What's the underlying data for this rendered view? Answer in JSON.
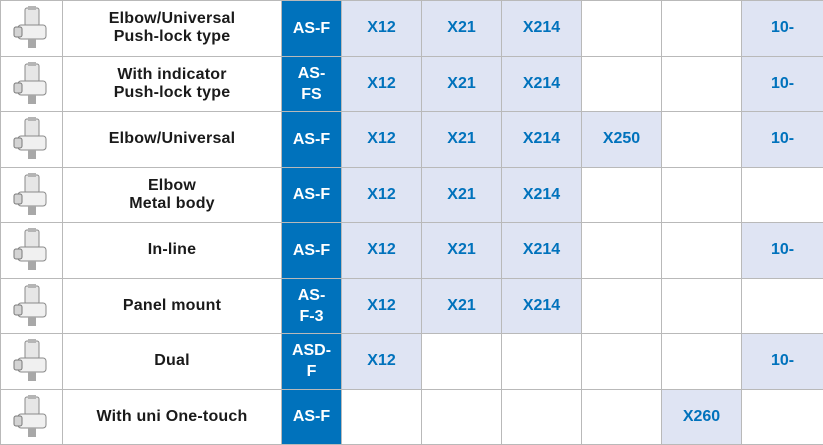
{
  "colors": {
    "model_bg": "#0072bc",
    "option_fill": "#dfe4f3",
    "option_text": "#0072bc",
    "grid": "#b9b9b9"
  },
  "rows": [
    {
      "icon": "elbow-universal-pushlock-fitting-icon",
      "description": "Elbow/Universal\nPush-lock type",
      "model": "AS-F",
      "options": [
        "X12",
        "X21",
        "X214",
        "",
        "",
        "10-"
      ]
    },
    {
      "icon": "indicator-pushlock-fitting-icon",
      "description": "With indicator\nPush-lock type",
      "model": "AS-\nFS",
      "options": [
        "X12",
        "X21",
        "X214",
        "",
        "",
        "10-"
      ]
    },
    {
      "icon": "elbow-universal-fitting-icon",
      "description": "Elbow/Universal",
      "model": "AS-F",
      "options": [
        "X12",
        "X21",
        "X214",
        "X250",
        "",
        "10-"
      ]
    },
    {
      "icon": "elbow-metal-body-fitting-icon",
      "description": "Elbow\nMetal body",
      "model": "AS-F",
      "options": [
        "X12",
        "X21",
        "X214",
        "",
        "",
        ""
      ]
    },
    {
      "icon": "inline-fitting-icon",
      "description": "In-line",
      "model": "AS-F",
      "options": [
        "X12",
        "X21",
        "X214",
        "",
        "",
        "10-"
      ]
    },
    {
      "icon": "panel-mount-fitting-icon",
      "description": "Panel mount",
      "model": "AS-\nF-3",
      "options": [
        "X12",
        "X21",
        "X214",
        "",
        "",
        ""
      ]
    },
    {
      "icon": "dual-fitting-icon",
      "description": "Dual",
      "model": "ASD-\nF",
      "options": [
        "X12",
        "",
        "",
        "",
        "",
        "10-"
      ]
    },
    {
      "icon": "uni-one-touch-fitting-icon",
      "description": "With uni One-touch",
      "model": "AS-F",
      "options": [
        "",
        "",
        "",
        "",
        "X260",
        ""
      ]
    }
  ]
}
